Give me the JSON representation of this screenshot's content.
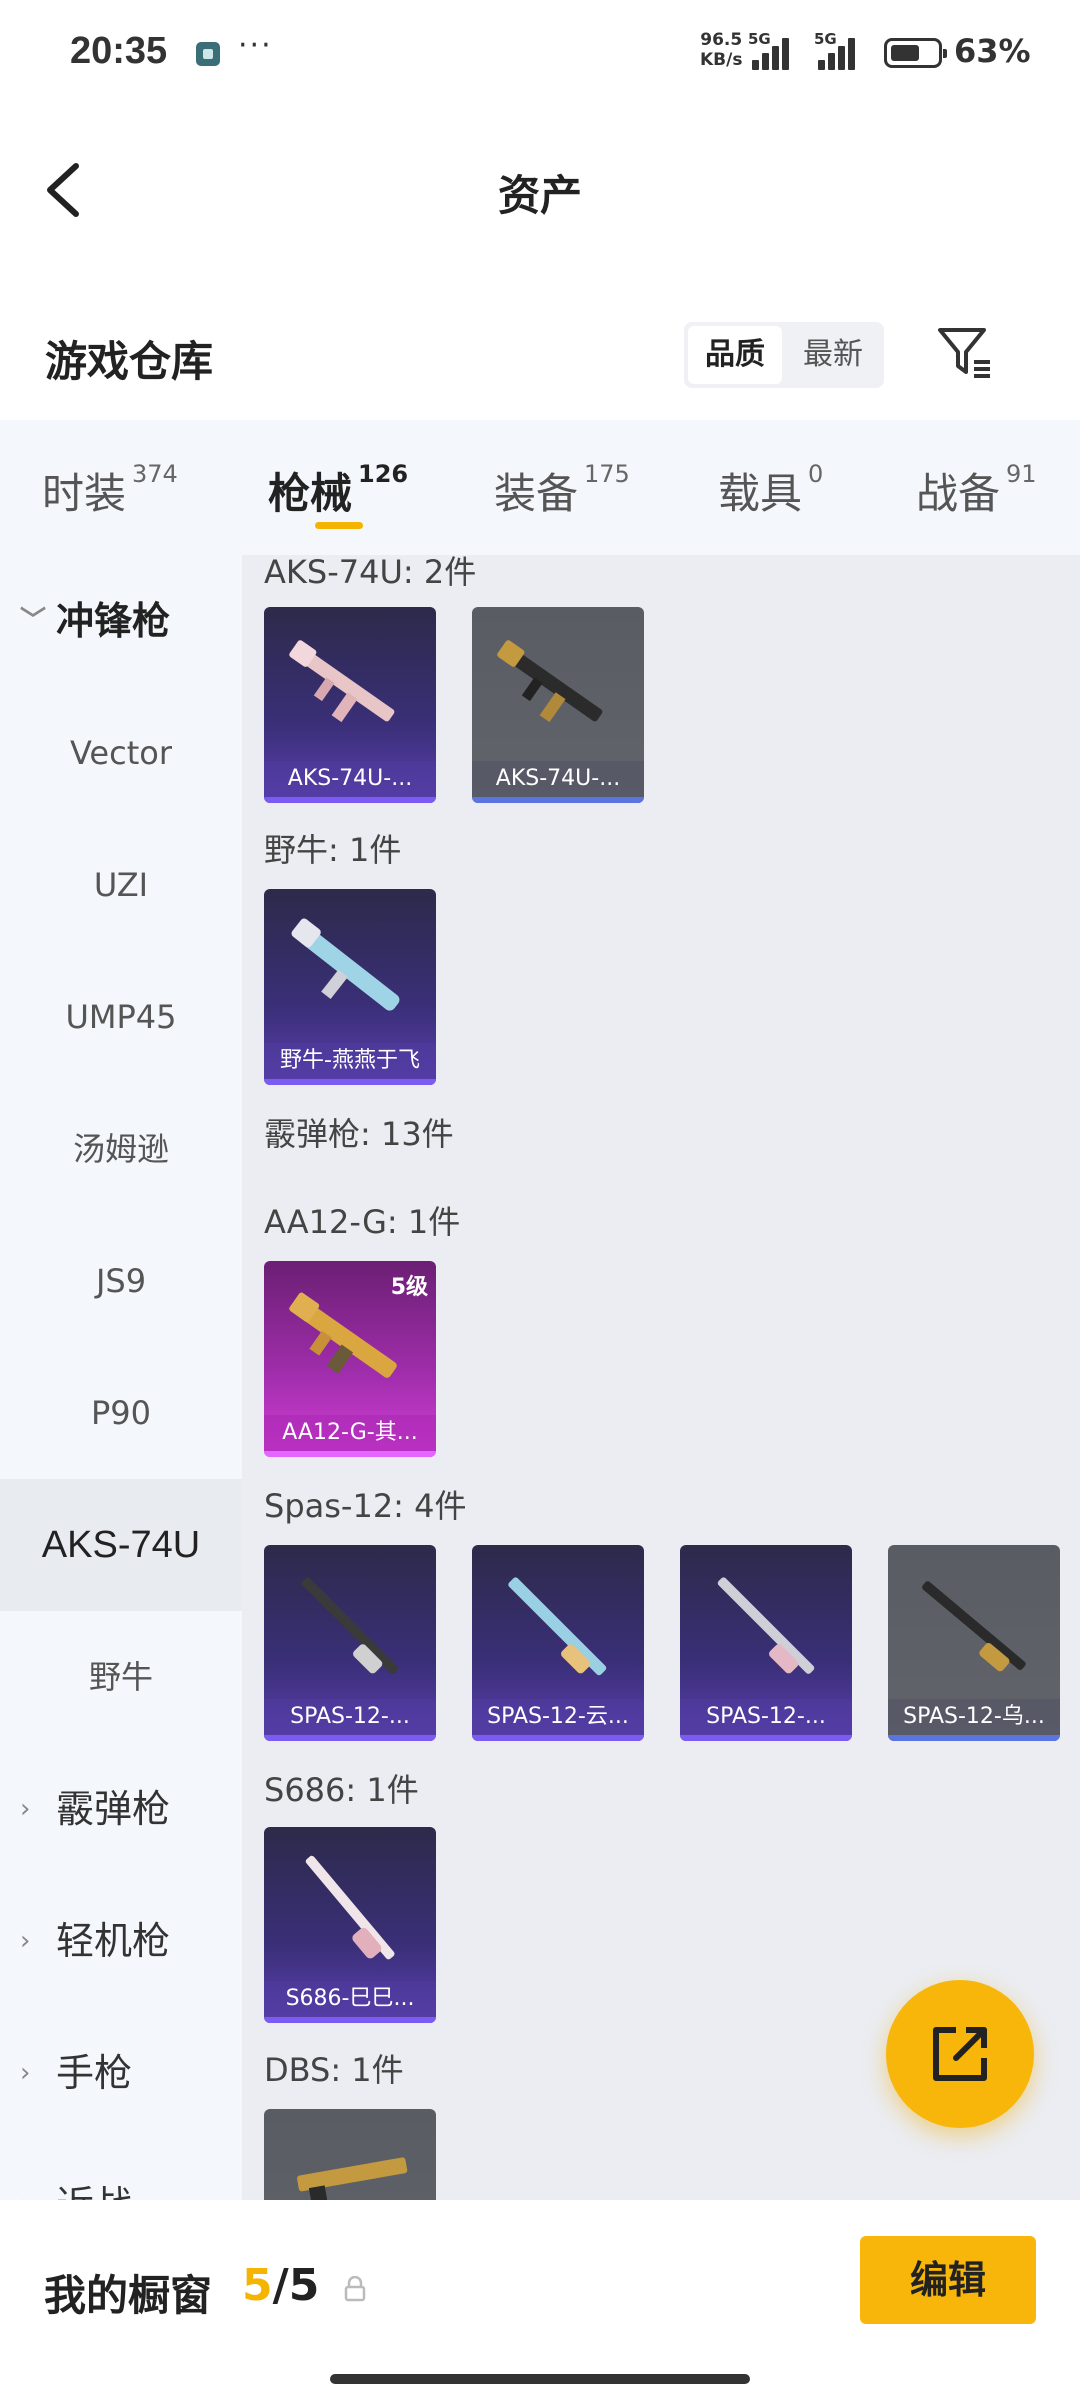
{
  "status_bar": {
    "time": "20:35",
    "dots": "···",
    "net_speed_value": "96.5",
    "net_speed_unit": "KB/s",
    "sim1": "5G",
    "sim2": "5G",
    "battery_percent": "63%",
    "battery_level": 0.63
  },
  "header": {
    "title": "资产"
  },
  "warehouse": {
    "title": "游戏仓库",
    "sort_options": [
      "品质",
      "最新"
    ],
    "sort_selected": "品质"
  },
  "categories": [
    {
      "label": "时装",
      "count": "374"
    },
    {
      "label": "枪械",
      "count": "126",
      "active": true
    },
    {
      "label": "装备",
      "count": "175"
    },
    {
      "label": "载具",
      "count": "0"
    },
    {
      "label": "战备",
      "count": "91"
    }
  ],
  "sidebar": {
    "group_smg": "冲锋枪",
    "smg_items": [
      "Vector",
      "UZI",
      "UMP45",
      "汤姆逊",
      "JS9",
      "P90",
      "AKS-74U",
      "野牛"
    ],
    "selected": "AKS-74U",
    "group_shotgun": "霰弹枪",
    "group_lmg": "轻机枪",
    "group_pistol": "手枪",
    "group_melee": "近战"
  },
  "sections": {
    "aks": {
      "title": "AKS-74U: 2件",
      "cards": [
        "AKS-74U-...",
        "AKS-74U-..."
      ]
    },
    "bizon": {
      "title": "野牛: 1件",
      "cards": [
        "野牛-燕燕于飞"
      ]
    },
    "shotgun_group": {
      "title": "霰弹枪: 13件"
    },
    "aa12": {
      "title": "AA12-G: 1件",
      "cards": [
        "AA12-G-其..."
      ],
      "level": "5级"
    },
    "spas": {
      "title": "Spas-12: 4件",
      "cards": [
        "SPAS-12-...",
        "SPAS-12-云...",
        "SPAS-12-...",
        "SPAS-12-乌..."
      ]
    },
    "s686": {
      "title": "S686: 1件",
      "cards": [
        "S686-巳巳..."
      ]
    },
    "dbs": {
      "title": "DBS: 1件"
    }
  },
  "bottom_bar": {
    "window_label": "我的橱窗",
    "used": "5",
    "separator": "/",
    "total": "5",
    "edit_label": "编辑"
  },
  "colors": {
    "accent": "#f8b60b",
    "rarity_purple": "#7b5bf2",
    "rarity_gray": "#5a75e0",
    "rarity_pink": "#e266ff"
  }
}
